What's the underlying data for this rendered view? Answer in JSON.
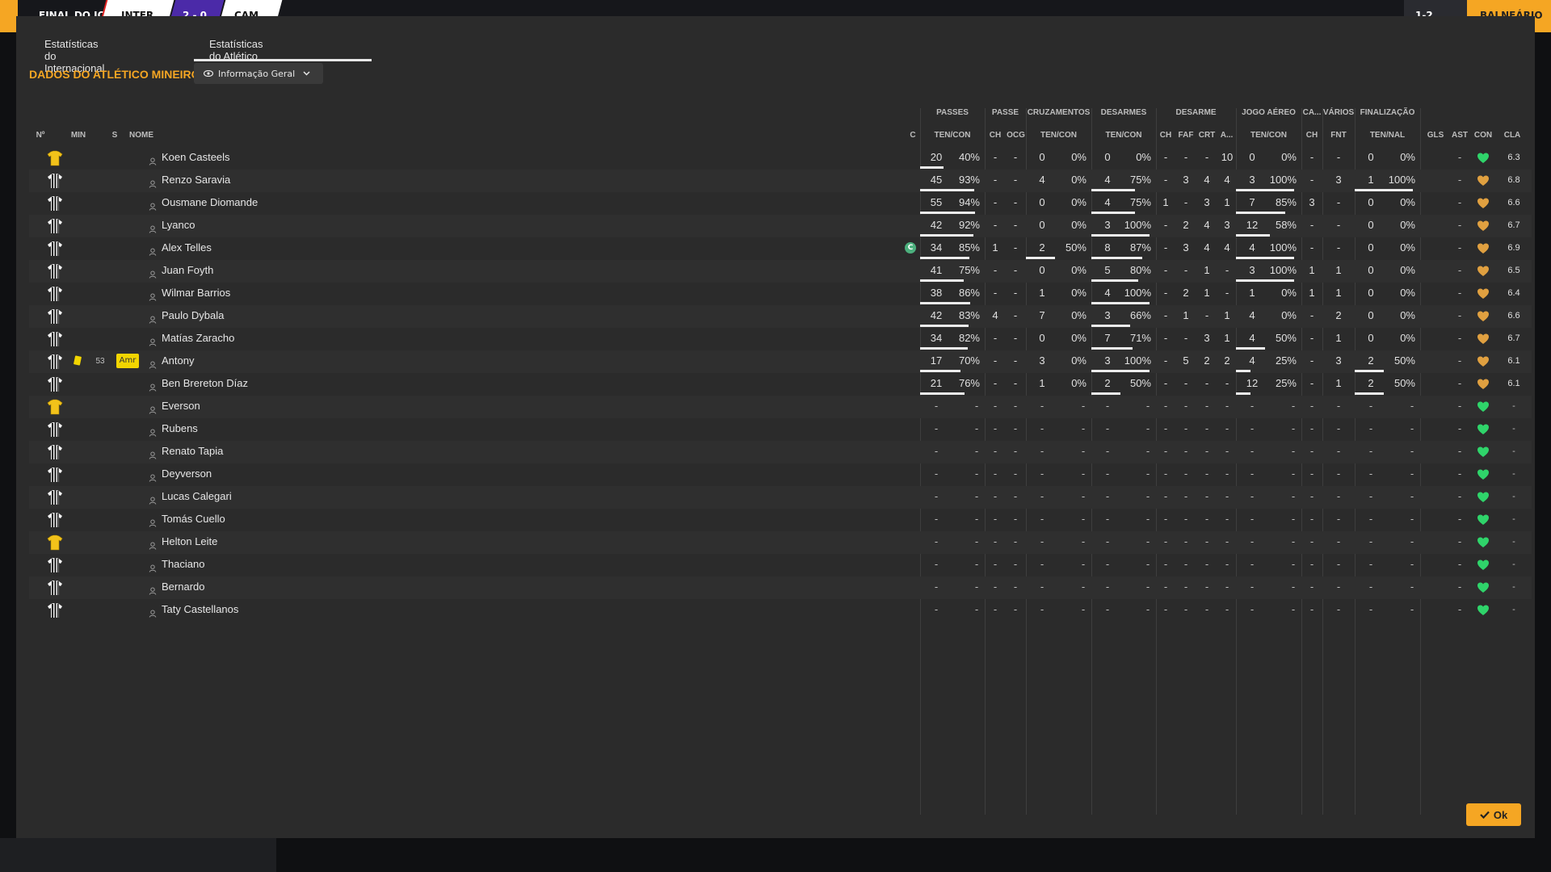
{
  "topbar": {
    "match_label": "FINAL DO JOGO",
    "home": "INTER",
    "score": "2 - 0",
    "away": "CAM",
    "right_button": "BALNEÁRIO",
    "right_small": "1-2"
  },
  "tabs": [
    {
      "label": "Estatísticas do Internacional",
      "active": false
    },
    {
      "label": "Estatísticas do Atlético Mineiro",
      "active": true
    }
  ],
  "section_title": "DADOS DO ATLÉTICO MINEIRO",
  "view_select": "Informação Geral",
  "headers": {
    "groups": {
      "passes": "PASSES",
      "passe": "PASSE",
      "cruzamentos": "CRUZAMENTOS",
      "desarmes": "DESARMES",
      "desarme": "DESARME",
      "jogo_aereo": "JOGO AÉREO",
      "ca": "CA...",
      "varios": "VÁRIOS",
      "finalizacao": "FINALIZAÇÃO"
    },
    "cols": {
      "num": "Nº",
      "min": "MIN",
      "s": "S",
      "nome": "NOME",
      "c": "C",
      "passes": "TEN/CON",
      "passe_ch": "CH",
      "passe_ocg": "OCG",
      "cruz": "TEN/CON",
      "desarmes": "TEN/CON",
      "des_ch": "CH",
      "des_faf": "FAF",
      "des_crt": "CRT",
      "des_a": "A...",
      "aereo": "TEN/CON",
      "ca_ch": "CH",
      "fnt": "FNT",
      "fin": "TEN/NAL",
      "gls": "GLS",
      "ast": "AST",
      "con": "CON",
      "cla": "CLA"
    }
  },
  "players": [
    {
      "shirt": "gk",
      "name": "Koen Casteels",
      "pass": [
        "20",
        "40%"
      ],
      "pass_fill": 0.4,
      "pch": "-",
      "pocg": "-",
      "cruz": [
        "0",
        "0%"
      ],
      "cruz_fill": 0,
      "des": [
        "0",
        "0%"
      ],
      "des_fill": 0,
      "dch": "-",
      "faf": "-",
      "crt": "-",
      "a": "10",
      "aer": [
        "0",
        "0%"
      ],
      "aer_fill": 0,
      "cach": "-",
      "fnt": "-",
      "fin": [
        "0",
        "0%"
      ],
      "fin_fill": 0,
      "gls": "",
      "ast": "-",
      "con": "green",
      "cla": "6.3"
    },
    {
      "shirt": "st",
      "name": "Renzo Saravia",
      "pass": [
        "45",
        "93%"
      ],
      "pass_fill": 0.93,
      "pch": "-",
      "pocg": "-",
      "cruz": [
        "4",
        "0%"
      ],
      "cruz_fill": 0,
      "des": [
        "4",
        "75%"
      ],
      "des_fill": 0.75,
      "dch": "-",
      "faf": "3",
      "crt": "4",
      "a": "4",
      "aer": [
        "3",
        "100%"
      ],
      "aer_fill": 1,
      "cach": "-",
      "fnt": "3",
      "fin": [
        "1",
        "100%"
      ],
      "fin_fill": 1,
      "gls": "",
      "ast": "-",
      "con": "orange",
      "cla": "6.8"
    },
    {
      "shirt": "st",
      "name": "Ousmane Diomande",
      "pass": [
        "55",
        "94%"
      ],
      "pass_fill": 0.94,
      "pch": "-",
      "pocg": "-",
      "cruz": [
        "0",
        "0%"
      ],
      "cruz_fill": 0,
      "des": [
        "4",
        "75%"
      ],
      "des_fill": 0.75,
      "dch": "1",
      "faf": "-",
      "crt": "3",
      "a": "1",
      "aer": [
        "7",
        "85%"
      ],
      "aer_fill": 0.85,
      "cach": "3",
      "fnt": "-",
      "fin": [
        "0",
        "0%"
      ],
      "fin_fill": 0,
      "gls": "",
      "ast": "-",
      "con": "orange",
      "cla": "6.6"
    },
    {
      "shirt": "st",
      "name": "Lyanco",
      "pass": [
        "42",
        "92%"
      ],
      "pass_fill": 0.92,
      "pch": "-",
      "pocg": "-",
      "cruz": [
        "0",
        "0%"
      ],
      "cruz_fill": 0,
      "des": [
        "3",
        "100%"
      ],
      "des_fill": 1,
      "dch": "-",
      "faf": "2",
      "crt": "4",
      "a": "3",
      "aer": [
        "12",
        "58%"
      ],
      "aer_fill": 0.58,
      "cach": "-",
      "fnt": "-",
      "fin": [
        "0",
        "0%"
      ],
      "fin_fill": 0,
      "gls": "",
      "ast": "-",
      "con": "orange",
      "cla": "6.7"
    },
    {
      "shirt": "st",
      "name": "Alex Telles",
      "pass": [
        "34",
        "85%"
      ],
      "pass_fill": 0.85,
      "pch": "1",
      "pocg": "-",
      "cruz": [
        "2",
        "50%"
      ],
      "cruz_fill": 0.5,
      "des": [
        "8",
        "87%"
      ],
      "des_fill": 0.87,
      "dch": "-",
      "faf": "3",
      "crt": "4",
      "a": "4",
      "aer": [
        "4",
        "100%"
      ],
      "aer_fill": 1,
      "cach": "-",
      "fnt": "-",
      "fin": [
        "0",
        "0%"
      ],
      "fin_fill": 0,
      "gls": "",
      "ast": "-",
      "con": "orange",
      "cla": "6.9",
      "captain": "C"
    },
    {
      "shirt": "st",
      "name": "Juan Foyth",
      "pass": [
        "41",
        "75%"
      ],
      "pass_fill": 0.75,
      "pch": "-",
      "pocg": "-",
      "cruz": [
        "0",
        "0%"
      ],
      "cruz_fill": 0,
      "des": [
        "5",
        "80%"
      ],
      "des_fill": 0.8,
      "dch": "-",
      "faf": "-",
      "crt": "1",
      "a": "-",
      "aer": [
        "3",
        "100%"
      ],
      "aer_fill": 1,
      "cach": "1",
      "fnt": "1",
      "fin": [
        "0",
        "0%"
      ],
      "fin_fill": 0,
      "gls": "",
      "ast": "-",
      "con": "orange",
      "cla": "6.5"
    },
    {
      "shirt": "st",
      "name": "Wilmar Barrios",
      "pass": [
        "38",
        "86%"
      ],
      "pass_fill": 0.86,
      "pch": "-",
      "pocg": "-",
      "cruz": [
        "1",
        "0%"
      ],
      "cruz_fill": 0,
      "des": [
        "4",
        "100%"
      ],
      "des_fill": 1,
      "dch": "-",
      "faf": "2",
      "crt": "1",
      "a": "-",
      "aer": [
        "1",
        "0%"
      ],
      "aer_fill": 0,
      "cach": "1",
      "fnt": "1",
      "fin": [
        "0",
        "0%"
      ],
      "fin_fill": 0,
      "gls": "",
      "ast": "-",
      "con": "orange",
      "cla": "6.4"
    },
    {
      "shirt": "st",
      "name": "Paulo Dybala",
      "pass": [
        "42",
        "83%"
      ],
      "pass_fill": 0.83,
      "pch": "4",
      "pocg": "-",
      "cruz": [
        "7",
        "0%"
      ],
      "cruz_fill": 0,
      "des": [
        "3",
        "66%"
      ],
      "des_fill": 0.66,
      "dch": "-",
      "faf": "1",
      "crt": "-",
      "a": "1",
      "aer": [
        "4",
        "0%"
      ],
      "aer_fill": 0,
      "cach": "-",
      "fnt": "2",
      "fin": [
        "0",
        "0%"
      ],
      "fin_fill": 0,
      "gls": "",
      "ast": "-",
      "con": "orange",
      "cla": "6.6"
    },
    {
      "shirt": "st",
      "name": "Matías Zaracho",
      "pass": [
        "34",
        "82%"
      ],
      "pass_fill": 0.82,
      "pch": "-",
      "pocg": "-",
      "cruz": [
        "0",
        "0%"
      ],
      "cruz_fill": 0,
      "des": [
        "7",
        "71%"
      ],
      "des_fill": 0.71,
      "dch": "-",
      "faf": "-",
      "crt": "3",
      "a": "1",
      "aer": [
        "4",
        "50%"
      ],
      "aer_fill": 0.5,
      "cach": "-",
      "fnt": "1",
      "fin": [
        "0",
        "0%"
      ],
      "fin_fill": 0,
      "gls": "",
      "ast": "-",
      "con": "orange",
      "cla": "6.7"
    },
    {
      "shirt": "st",
      "name": "Antony",
      "min": "53",
      "badge": "Amr",
      "pass": [
        "17",
        "70%"
      ],
      "pass_fill": 0.7,
      "pch": "-",
      "pocg": "-",
      "cruz": [
        "3",
        "0%"
      ],
      "cruz_fill": 0,
      "des": [
        "3",
        "100%"
      ],
      "des_fill": 1,
      "dch": "-",
      "faf": "5",
      "crt": "2",
      "a": "2",
      "aer": [
        "4",
        "25%"
      ],
      "aer_fill": 0.25,
      "cach": "-",
      "fnt": "3",
      "fin": [
        "2",
        "50%"
      ],
      "fin_fill": 0.5,
      "gls": "",
      "ast": "-",
      "con": "orange",
      "cla": "6.1",
      "yellow_card": true
    },
    {
      "shirt": "st",
      "name": "Ben Brereton Díaz",
      "pass": [
        "21",
        "76%"
      ],
      "pass_fill": 0.76,
      "pch": "-",
      "pocg": "-",
      "cruz": [
        "1",
        "0%"
      ],
      "cruz_fill": 0,
      "des": [
        "2",
        "50%"
      ],
      "des_fill": 0.5,
      "dch": "-",
      "faf": "-",
      "crt": "-",
      "a": "-",
      "aer": [
        "12",
        "25%"
      ],
      "aer_fill": 0.25,
      "cach": "-",
      "fnt": "1",
      "fin": [
        "2",
        "50%"
      ],
      "fin_fill": 0.5,
      "gls": "",
      "ast": "-",
      "con": "orange",
      "cla": "6.1"
    },
    {
      "shirt": "gk",
      "name": "Everson",
      "bench": true,
      "con": "green"
    },
    {
      "shirt": "st",
      "name": "Rubens",
      "bench": true,
      "con": "green"
    },
    {
      "shirt": "st",
      "name": "Renato Tapia",
      "bench": true,
      "con": "green"
    },
    {
      "shirt": "st",
      "name": "Deyverson",
      "bench": true,
      "con": "green"
    },
    {
      "shirt": "st",
      "name": "Lucas Calegari",
      "bench": true,
      "con": "green"
    },
    {
      "shirt": "st",
      "name": "Tomás Cuello",
      "bench": true,
      "con": "green"
    },
    {
      "shirt": "gk",
      "name": "Helton Leite",
      "bench": true,
      "con": "green"
    },
    {
      "shirt": "st",
      "name": "Thaciano",
      "bench": true,
      "con": "green"
    },
    {
      "shirt": "st",
      "name": "Bernardo",
      "bench": true,
      "con": "green"
    },
    {
      "shirt": "st",
      "name": "Taty Castellanos",
      "bench": true,
      "con": "green"
    }
  ],
  "ok_button": "Ok",
  "colors": {
    "accent": "#f5a623",
    "heart_green": "#2fd46a",
    "heart_orange": "#e0a040",
    "card_yellow": "#f2d500"
  }
}
